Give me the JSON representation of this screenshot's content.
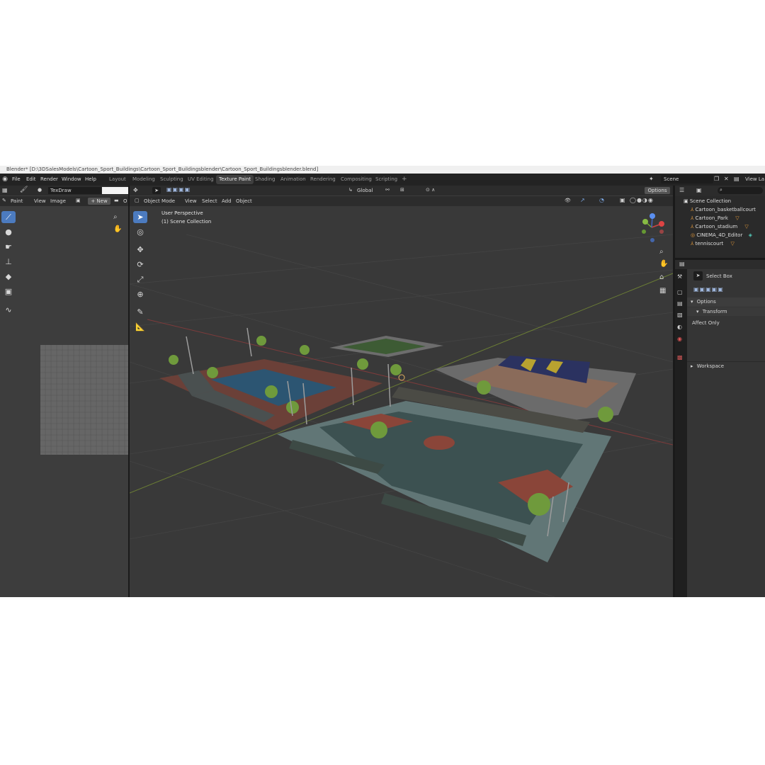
{
  "window": {
    "title": "Blender* [D:\\3DSalesModels\\Cartoon_Sport_Buildings\\Cartoon_Sport_Buildingsblender\\Cartoon_Sport_Buildingsblender.blend]"
  },
  "menu": [
    "File",
    "Edit",
    "Render",
    "Window",
    "Help"
  ],
  "workspaces": [
    "Layout",
    "Modeling",
    "Sculpting",
    "UV Editing",
    "Texture Paint",
    "Shading",
    "Animation",
    "Rendering",
    "Compositing",
    "Scripting"
  ],
  "active_workspace": "Texture Paint",
  "scene": {
    "name": "Scene",
    "view_layer": "View La"
  },
  "image_editor": {
    "brush": "TexDraw",
    "mode": "Paint",
    "menu": [
      "View",
      "Image"
    ],
    "new_label": "New",
    "cut_label": "O"
  },
  "viewport": {
    "mode": "Object Mode",
    "menu": [
      "View",
      "Select",
      "Add",
      "Object"
    ],
    "orientation": "Global",
    "options_label": "Options",
    "info_line1": "User Perspective",
    "info_line2": "(1) Scene Collection"
  },
  "outliner": {
    "root": "Scene Collection",
    "items": [
      "Cartoon_basketballcourt",
      "Cartoon_Park",
      "Cartoon_stadium",
      "CINEMA_4D_Editor",
      "tenniscourt"
    ]
  },
  "properties": {
    "tool": "Select Box",
    "options": "Options",
    "transform": "Transform",
    "affect_only": "Affect Only",
    "workspace": "Workspace"
  },
  "colors": {
    "accent": "#4c7bbf",
    "topbar": "#232323",
    "panel": "#3d3d3d",
    "viewport_bg": "#393939"
  },
  "icons": [
    "blender-logo-icon",
    "brush-icon",
    "fill-icon",
    "smear-icon",
    "clone-icon",
    "bucket-icon",
    "mask-icon",
    "line-icon",
    "zoom-icon",
    "hand-icon",
    "cursor-icon",
    "move-icon",
    "rotate-icon",
    "scale-icon",
    "transform-icon",
    "annotate-icon",
    "measure-icon",
    "camera-icon",
    "grid-icon",
    "gear-icon"
  ]
}
